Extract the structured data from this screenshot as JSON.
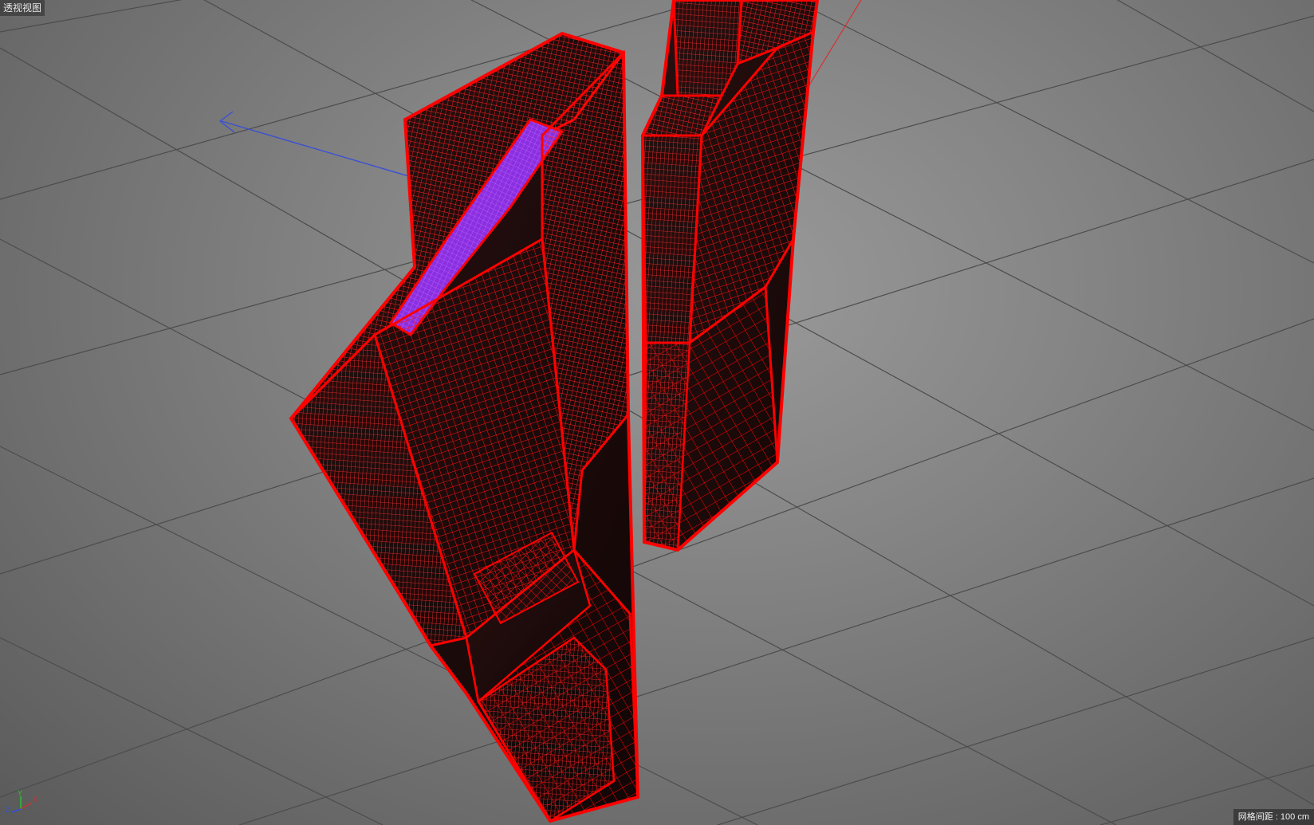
{
  "viewport": {
    "view_label": "透视视图",
    "grid_spacing_label": "网格间距 : 100 cm",
    "gizmo_axes": {
      "x": "X",
      "y": "Y",
      "z": "Z"
    },
    "colors": {
      "wireframe": "#ff0000",
      "wire_dense": "#ff1a1a",
      "selected_face": "#a040ff",
      "axis_x": "#d23030",
      "axis_y": "#30c030",
      "axis_z": "#3050e0",
      "grid_line": "#4a4a4a"
    }
  }
}
